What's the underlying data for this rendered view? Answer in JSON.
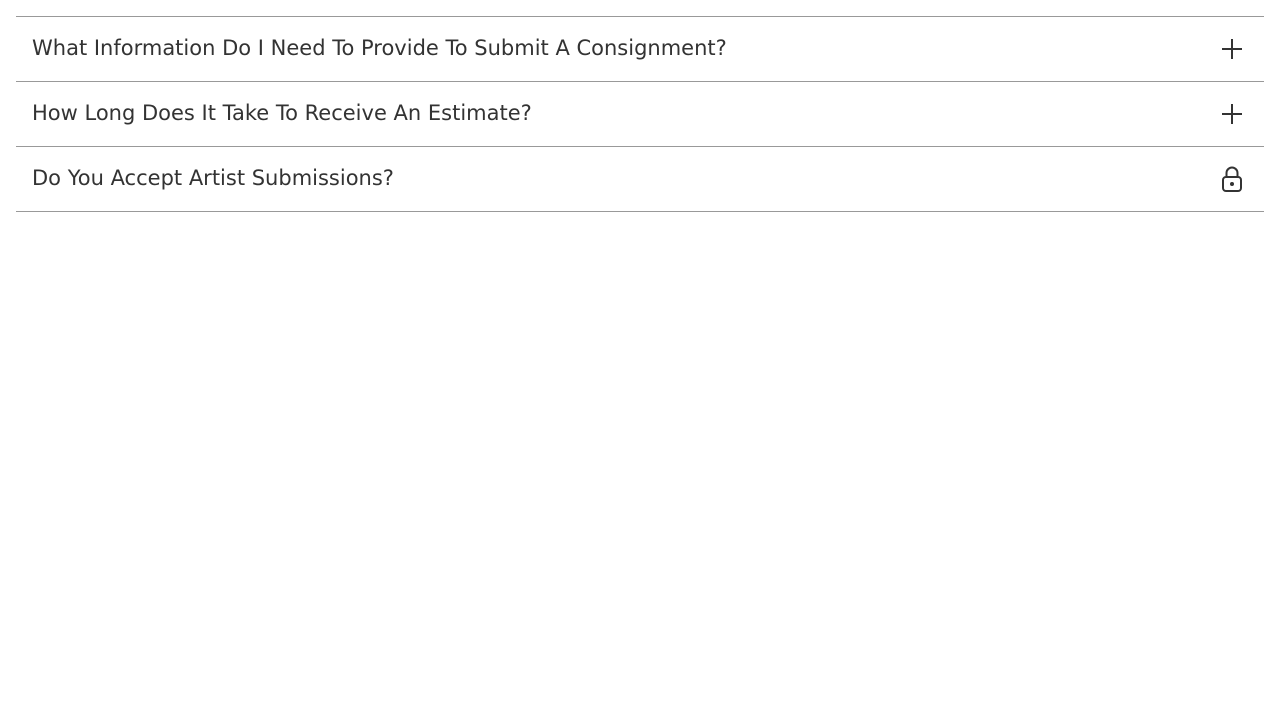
{
  "faq": {
    "items": [
      {
        "question": "What Information Do I Need To Provide To Submit A Consignment?",
        "icon": "plus-icon"
      },
      {
        "question": "How Long Does It Take To Receive An Estimate?",
        "icon": "plus-icon"
      },
      {
        "question": "Do You Accept Artist Submissions?",
        "icon": "lock-icon"
      }
    ]
  },
  "colors": {
    "text": "#333333",
    "divider": "#999999",
    "background": "#ffffff"
  }
}
